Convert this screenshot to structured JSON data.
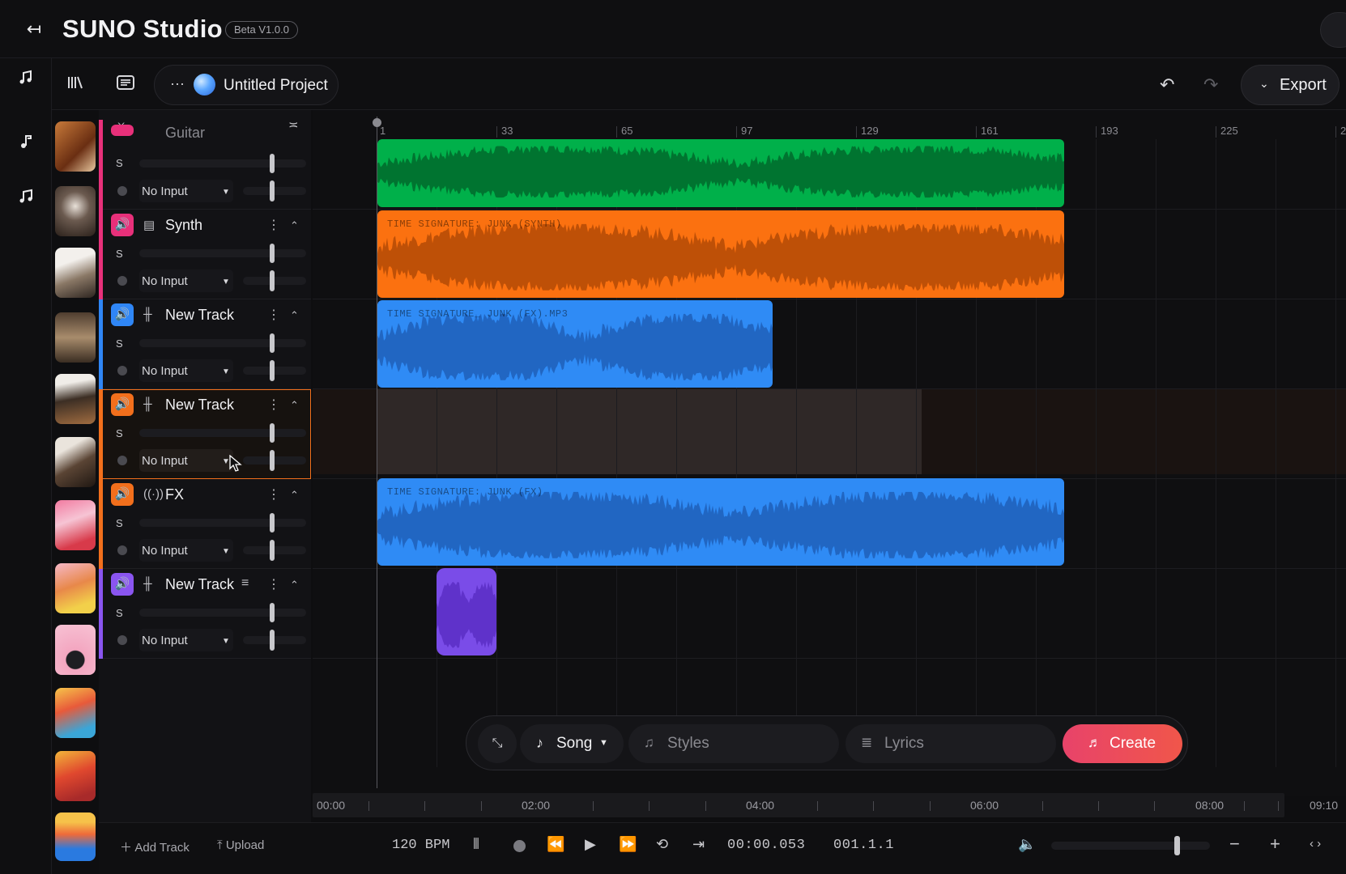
{
  "header": {
    "title": "SUNO Studio",
    "badge": "Beta V1.0.0"
  },
  "toolbar": {
    "project_name": "Untitled Project",
    "export_label": "Export"
  },
  "tracks": [
    {
      "name": "Guitar",
      "solo": "S",
      "input": "No Input",
      "color": "#e8307a"
    },
    {
      "name": "Synth",
      "solo": "S",
      "input": "No Input",
      "color": "#e8307a"
    },
    {
      "name": "New Track",
      "solo": "S",
      "input": "No Input",
      "color": "#2f86f6"
    },
    {
      "name": "New Track",
      "solo": "S",
      "input": "No Input",
      "color": "#f26f1c"
    },
    {
      "name": "FX",
      "solo": "S",
      "input": "No Input",
      "color": "#f26f1c"
    },
    {
      "name": "New Track",
      "solo": "S",
      "input": "No Input",
      "color": "#8a55f0"
    }
  ],
  "ruler": {
    "labels": [
      "1",
      "33",
      "65",
      "97",
      "129",
      "161",
      "193",
      "225",
      "2"
    ]
  },
  "clips": [
    {
      "label": "",
      "color": "#00b04a",
      "wave_color": "#006a2c"
    },
    {
      "label": "TIME SIGNATURE: JUNK (SYNTH)",
      "color": "#fb7110",
      "wave_color": "#b34a06"
    },
    {
      "label": "TIME SIGNATURE_ JUNK (FX).MP3",
      "color": "#2f8bf5",
      "wave_color": "#1e5fb8"
    },
    {
      "label": "TIME SIGNATURE: JUNK (FX)",
      "color": "#2f8bf5",
      "wave_color": "#1e5fb8"
    },
    {
      "label": "",
      "color": "#7a4ce8",
      "wave_color": "#5a2ec4"
    }
  ],
  "composer": {
    "mode": "Song",
    "styles_placeholder": "Styles",
    "lyrics_placeholder": "Lyrics",
    "create_label": "Create"
  },
  "overview": {
    "labels": [
      "00:00",
      "02:00",
      "04:00",
      "06:00",
      "08:00"
    ],
    "end_time": "09:10"
  },
  "transport": {
    "add_track": "Add Track",
    "upload": "Upload",
    "bpm": "120 BPM",
    "time": "00:00.053",
    "position": "001.1.1"
  },
  "icons": {
    "back": "arrow-left-icon",
    "mute": "speaker-icon",
    "music": "music-note-icon"
  }
}
